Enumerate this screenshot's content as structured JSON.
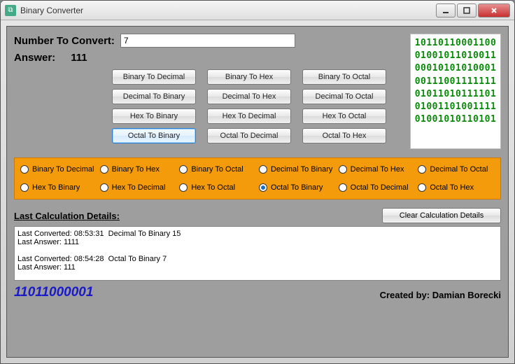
{
  "window": {
    "title": "Binary Converter"
  },
  "input": {
    "label": "Number To Convert:",
    "value": "7"
  },
  "answer": {
    "label": "Answer:",
    "value": "111"
  },
  "buttons": [
    {
      "label": "Binary To Decimal",
      "selected": false
    },
    {
      "label": "Binary To Hex",
      "selected": false
    },
    {
      "label": "Binary To Octal",
      "selected": false
    },
    {
      "label": "Decimal To Binary",
      "selected": false
    },
    {
      "label": "Decimal To Hex",
      "selected": false
    },
    {
      "label": "Decimal To Octal",
      "selected": false
    },
    {
      "label": "Hex To Binary",
      "selected": false
    },
    {
      "label": "Hex To Decimal",
      "selected": false
    },
    {
      "label": "Hex To Octal",
      "selected": false
    },
    {
      "label": "Octal To Binary",
      "selected": true
    },
    {
      "label": "Octal To Decimal",
      "selected": false
    },
    {
      "label": "Octal To Hex",
      "selected": false
    }
  ],
  "decoration": "10110110001100\n01001011010011\n00010101010001\n00111001111111\n01011010111101\n01001101001111\n01001010110101",
  "radios": [
    {
      "label": "Binary To Decimal",
      "selected": false
    },
    {
      "label": "Binary To Hex",
      "selected": false
    },
    {
      "label": "Binary To Octal",
      "selected": false
    },
    {
      "label": "Decimal To Binary",
      "selected": false
    },
    {
      "label": "Decimal To Hex",
      "selected": false
    },
    {
      "label": "Decimal To Octal",
      "selected": false
    },
    {
      "label": "Hex To Binary",
      "selected": false
    },
    {
      "label": "Hex To Decimal",
      "selected": false
    },
    {
      "label": "Hex To Octal",
      "selected": false
    },
    {
      "label": "Octal To Binary",
      "selected": true
    },
    {
      "label": "Octal To Decimal",
      "selected": false
    },
    {
      "label": "Octal To Hex",
      "selected": false
    }
  ],
  "details": {
    "header": "Last Calculation Details:",
    "clear_label": "Clear Calculation Details",
    "log": "Last Converted: 08:53:31  Decimal To Binary 15\nLast Answer: 1111\n\nLast Converted: 08:54:28  Octal To Binary 7\nLast Answer: 111"
  },
  "footer": {
    "binary": "11011000001",
    "credit": "Created by: Damian Borecki"
  }
}
